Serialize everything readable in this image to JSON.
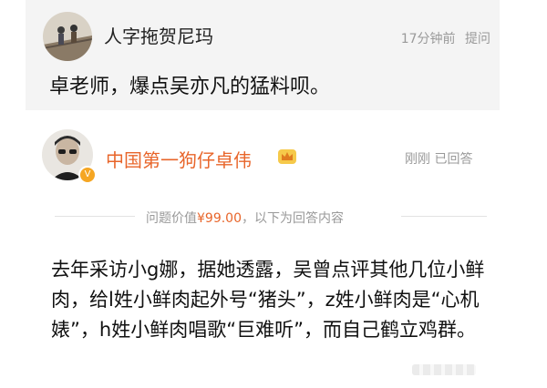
{
  "question": {
    "asker_name": "人字拖贺尼玛",
    "time": "17分钟前",
    "report_label": "提问",
    "text": "卓老师，爆点吴亦凡的猛料呗。"
  },
  "answer": {
    "answerer_name": "中国第一狗仔卓伟",
    "time": "刚刚",
    "status": "已回答",
    "price_prefix": "问题价值",
    "price": "¥99.00",
    "price_suffix": "，以下为回答内容",
    "body": "去年采访小g娜，据她透露，吴曾点评其他几位小鲜肉，给l姓小鲜肉起外号“猪头”，z姓小鲜肉是“心机婊”，h姓小鲜肉唱歌“巨难听”，而自己鹤立鸡群。"
  },
  "colors": {
    "answerer_name": "#e8652a",
    "meta_gray": "#999999",
    "question_bg": "#f4f4f4"
  },
  "icons": {
    "crown": "crown-icon",
    "vip": "vip-badge-icon"
  }
}
